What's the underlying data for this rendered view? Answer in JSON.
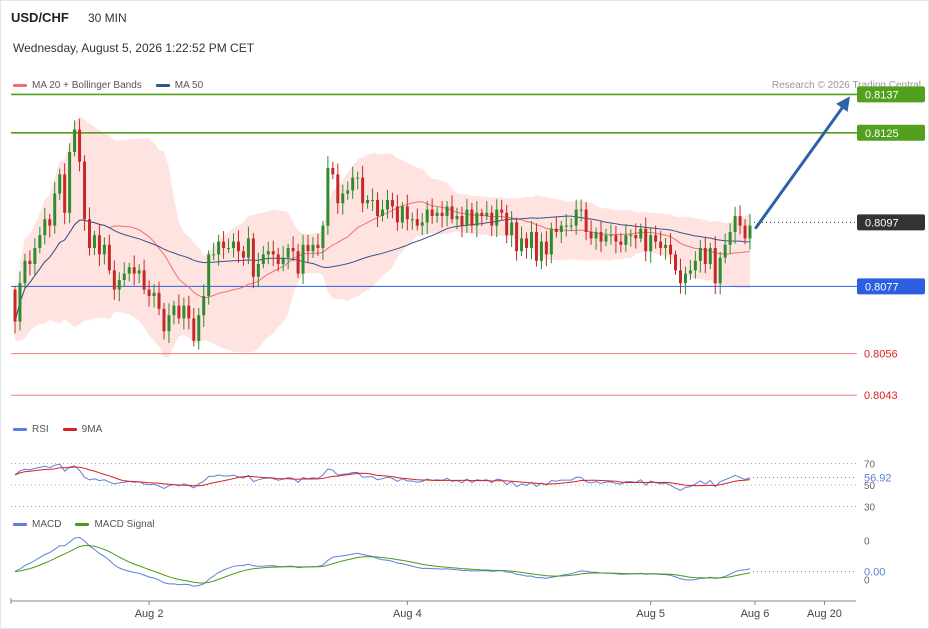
{
  "header": {
    "symbol": "USD/CHF",
    "timeframe": "30 MIN",
    "datetime": "Wednesday, August 5, 2026 1:22:52 PM CET",
    "credit": "Research © 2026 Trading Central"
  },
  "colors": {
    "bull": "#2e8b2e",
    "bear": "#c62828",
    "band_fill": "#ffd9d6",
    "ma20": "#f07070",
    "ma50": "#33558f",
    "resistance": "#52a01e",
    "pivot": "#2b5fe0",
    "support": "#f08080",
    "current": "#333333",
    "arrow": "#2d62a8",
    "rsi": "#5b7fdc",
    "rsi_ma": "#d92020",
    "macd": "#5b7fdc",
    "macd_signal": "#4a9a1a"
  },
  "chart_data": [
    {
      "type": "candlestick",
      "pane": "price",
      "legend": [
        {
          "name": "MA 20 + Bollinger Bands",
          "color": "#f07070"
        },
        {
          "name": "MA 50",
          "color": "#33558f"
        }
      ],
      "ylim": [
        0.8034,
        0.8144
      ],
      "xlim": [
        0,
        148
      ],
      "x_ticks": [
        {
          "x": 27,
          "label": "Aug 2"
        },
        {
          "x": 79,
          "label": "Aug 4"
        },
        {
          "x": 128,
          "label": "Aug 5"
        },
        {
          "x": 149,
          "label": "Aug 6"
        },
        {
          "x": 163,
          "label": "Aug 20"
        }
      ],
      "levels": [
        {
          "value": 0.8137,
          "label": "0.8137",
          "kind": "resistance"
        },
        {
          "value": 0.8125,
          "label": "0.8125",
          "kind": "resistance"
        },
        {
          "value": 0.8097,
          "label": "0.8097",
          "kind": "current"
        },
        {
          "value": 0.8077,
          "label": "0.8077",
          "kind": "pivot"
        },
        {
          "value": 0.8056,
          "label": "0.8056",
          "kind": "support"
        },
        {
          "value": 0.8043,
          "label": "0.8043",
          "kind": "support"
        }
      ],
      "close": [
        0.8066,
        0.8078,
        0.8085,
        0.8084,
        0.8089,
        0.8093,
        0.8098,
        0.8096,
        0.8106,
        0.8112,
        0.81,
        0.8119,
        0.8126,
        0.8116,
        0.8098,
        0.8089,
        0.8093,
        0.8087,
        0.809,
        0.8082,
        0.8076,
        0.8079,
        0.8081,
        0.8083,
        0.8081,
        0.8082,
        0.8076,
        0.8074,
        0.8075,
        0.807,
        0.8063,
        0.8068,
        0.8071,
        0.8067,
        0.8071,
        0.8067,
        0.806,
        0.8068,
        0.8074,
        0.8087,
        0.8087,
        0.8091,
        0.8089,
        0.8089,
        0.8091,
        0.8088,
        0.8086,
        0.8092,
        0.808,
        0.8084,
        0.8087,
        0.8088,
        0.8087,
        0.8084,
        0.8086,
        0.8089,
        0.8088,
        0.8081,
        0.809,
        0.8088,
        0.809,
        0.8089,
        0.8096,
        0.8114,
        0.8112,
        0.8103,
        0.8106,
        0.8107,
        0.8111,
        0.8111,
        0.8103,
        0.8104,
        0.8104,
        0.8099,
        0.8101,
        0.8104,
        0.8102,
        0.8097,
        0.8102,
        0.8098,
        0.8098,
        0.8096,
        0.8097,
        0.8101,
        0.8099,
        0.81,
        0.8099,
        0.8102,
        0.8098,
        0.8099,
        0.8096,
        0.8101,
        0.8096,
        0.81,
        0.8099,
        0.81,
        0.8096,
        0.8101,
        0.81,
        0.8093,
        0.8097,
        0.8088,
        0.8092,
        0.8089,
        0.8094,
        0.8085,
        0.8091,
        0.8087,
        0.8095,
        0.8094,
        0.8096,
        0.8096,
        0.8096,
        0.8101,
        0.8101,
        0.8094,
        0.8092,
        0.8094,
        0.8091,
        0.8093,
        0.8093,
        0.8091,
        0.809,
        0.8093,
        0.8093,
        0.8092,
        0.8095,
        0.8088,
        0.8093,
        0.8091,
        0.8089,
        0.809,
        0.8087,
        0.8082,
        0.8078,
        0.8081,
        0.8082,
        0.8085,
        0.8089,
        0.8084,
        0.8089,
        0.8078,
        0.8086,
        0.809,
        0.8094,
        0.8099,
        0.8096,
        0.8092,
        0.8096
      ],
      "ma20_last": 0.8088,
      "ma50_last": 0.8091
    },
    {
      "type": "line",
      "pane": "rsi",
      "legend": [
        {
          "name": "RSI",
          "color": "#5b7fdc"
        },
        {
          "name": "9MA",
          "color": "#d92020"
        }
      ],
      "ylim": [
        22,
        92
      ],
      "y_ticks": [
        {
          "value": 70,
          "label": "70"
        },
        {
          "value": 50,
          "label": "50"
        },
        {
          "value": 30,
          "label": "30"
        }
      ],
      "last_value_label": "56.92",
      "last_value": 56.92
    },
    {
      "type": "line",
      "pane": "macd",
      "legend": [
        {
          "name": "MACD",
          "color": "#5b7fdc"
        },
        {
          "name": "MACD Signal",
          "color": "#4a9a1a"
        }
      ],
      "ylim": [
        -0.0011,
        0.0016
      ],
      "y_ticks": [
        {
          "value": 0.0012,
          "label": "0"
        },
        {
          "value": -0.0003,
          "label": "0"
        }
      ],
      "last_value_label": "0.00",
      "last_value": 0.0
    }
  ]
}
